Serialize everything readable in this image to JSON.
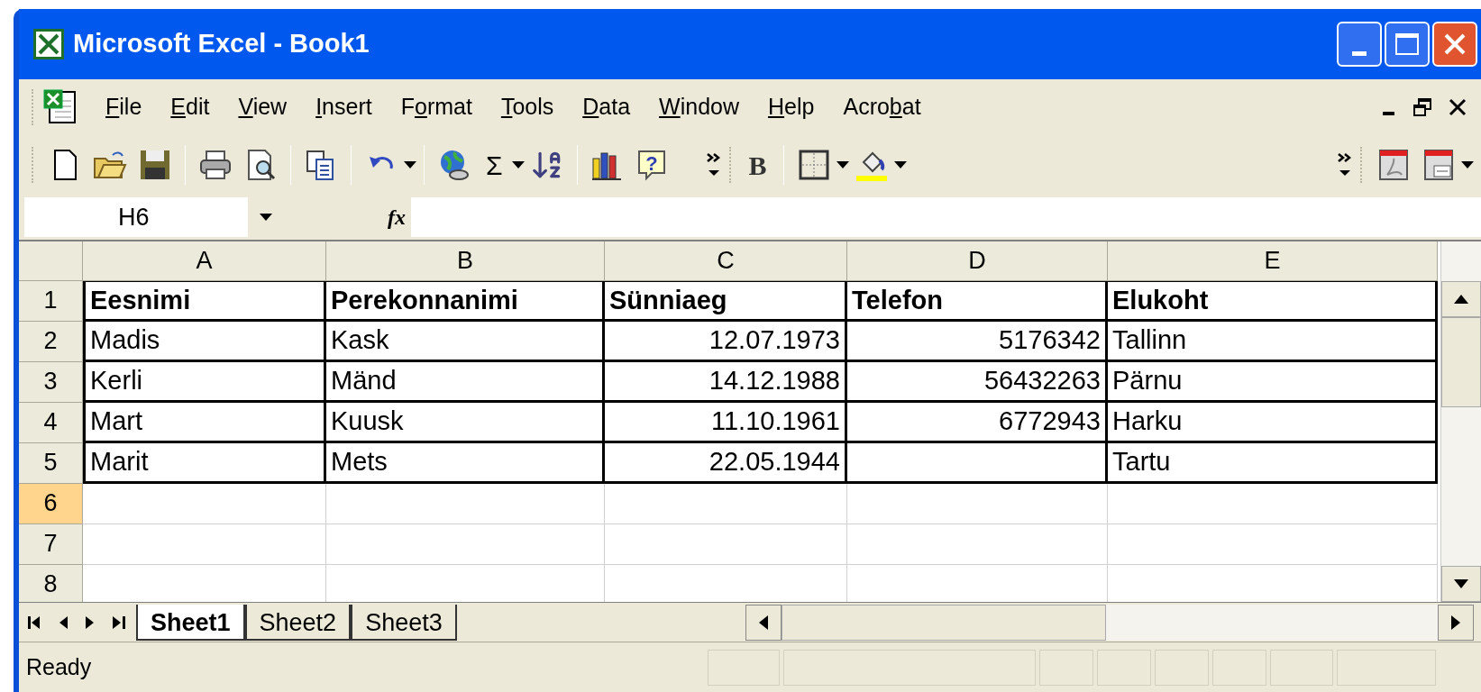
{
  "window": {
    "title": "Microsoft Excel - Book1"
  },
  "menu": [
    {
      "key": "F",
      "after": "ile"
    },
    {
      "key": "E",
      "after": "dit"
    },
    {
      "key": "V",
      "after": "iew"
    },
    {
      "key": "I",
      "after": "nsert"
    },
    {
      "before": "F",
      "key": "o",
      "after": "rmat"
    },
    {
      "key": "T",
      "after": "ools"
    },
    {
      "key": "D",
      "after": "ata"
    },
    {
      "key": "W",
      "after": "indow"
    },
    {
      "key": "H",
      "after": "elp"
    },
    {
      "before": "Acro",
      "key": "b",
      "after": "at"
    }
  ],
  "toolbar": {
    "autosum": "Σ",
    "help": "?",
    "bold": "B"
  },
  "formula_bar": {
    "name_box": "H6",
    "fx": "fx"
  },
  "sheet": {
    "columns": [
      "A",
      "B",
      "C",
      "D",
      "E"
    ],
    "rows": [
      {
        "header": "1",
        "selected": false,
        "bold": true,
        "bordered": true,
        "cells": [
          {
            "kind": "label",
            "text": "Eesnimi"
          },
          {
            "kind": "label",
            "text": "Perekonnanimi"
          },
          {
            "kind": "label",
            "text": "Sünniaeg"
          },
          {
            "kind": "label",
            "text": "Telefon"
          },
          {
            "kind": "label",
            "text": "Elukoht"
          }
        ]
      },
      {
        "header": "2",
        "selected": false,
        "bold": false,
        "bordered": true,
        "cells": [
          {
            "kind": "label",
            "text": "Madis"
          },
          {
            "kind": "label",
            "text": "Kask"
          },
          {
            "kind": "number",
            "text": "12.07.1973"
          },
          {
            "kind": "number",
            "text": "5176342"
          },
          {
            "kind": "label",
            "text": "Tallinn"
          }
        ]
      },
      {
        "header": "3",
        "selected": false,
        "bold": false,
        "bordered": true,
        "cells": [
          {
            "kind": "label",
            "text": "Kerli"
          },
          {
            "kind": "label",
            "text": "Mänd"
          },
          {
            "kind": "number",
            "text": "14.12.1988"
          },
          {
            "kind": "number",
            "text": "56432263"
          },
          {
            "kind": "label",
            "text": "Pärnu"
          }
        ]
      },
      {
        "header": "4",
        "selected": false,
        "bold": false,
        "bordered": true,
        "cells": [
          {
            "kind": "label",
            "text": "Mart"
          },
          {
            "kind": "label",
            "text": "Kuusk"
          },
          {
            "kind": "number",
            "text": "11.10.1961"
          },
          {
            "kind": "number",
            "text": "6772943"
          },
          {
            "kind": "label",
            "text": "Harku"
          }
        ]
      },
      {
        "header": "5",
        "selected": false,
        "bold": false,
        "bordered": true,
        "cells": [
          {
            "kind": "label",
            "text": "Marit"
          },
          {
            "kind": "label",
            "text": "Mets"
          },
          {
            "kind": "number",
            "text": "22.05.1944"
          },
          {
            "kind": "empty"
          },
          {
            "kind": "label",
            "text": "Tartu"
          }
        ]
      },
      {
        "header": "6",
        "selected": true,
        "bordered": false,
        "cells": []
      },
      {
        "header": "7",
        "selected": false,
        "bordered": false,
        "cells": []
      },
      {
        "header": "8",
        "selected": false,
        "bordered": false,
        "cells": []
      }
    ]
  },
  "sheet_tabs": [
    {
      "label": "Sheet1",
      "selected": true
    },
    {
      "label": "Sheet2",
      "selected": false
    },
    {
      "label": "Sheet3",
      "selected": false
    }
  ],
  "status_bar": {
    "text": "Ready"
  }
}
